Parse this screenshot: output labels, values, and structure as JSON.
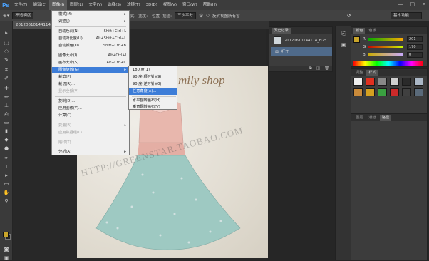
{
  "app": {
    "logo": "Ps"
  },
  "menubar": {
    "items": [
      "文件(F)",
      "编辑(E)",
      "图像(I)",
      "图层(L)",
      "文字(Y)",
      "选择(S)",
      "滤镜(T)",
      "3D(D)",
      "视图(V)",
      "窗口(W)",
      "帮助(H)"
    ],
    "active_index": 2,
    "window_controls": [
      "—",
      "□",
      "✕"
    ]
  },
  "options_bar": {
    "mode_label": "不透明度",
    "sample_label": "样式:",
    "sample_value": "正常",
    "width_label": "宽度:",
    "position_label": "位置",
    "interpolation_label": "插值:",
    "interpolation_value": "三次平分",
    "interpolation_options": [
      "三次平分"
    ],
    "checkbox_label": "旋转视图所有窗",
    "workspace_value": "基本功能"
  },
  "document_tab": {
    "label": "20120610144114_H25..."
  },
  "image_menu": {
    "rows": [
      {
        "label": "模式(M)",
        "shortcut": "",
        "submenu": true,
        "disabled": false
      },
      {
        "label": "调整(J)",
        "shortcut": "",
        "submenu": true,
        "disabled": false
      },
      {
        "label": "自动色调(N)",
        "shortcut": "Shift+Ctrl+L",
        "submenu": false,
        "disabled": false
      },
      {
        "label": "自动对比度(U)",
        "shortcut": "Alt+Shift+Ctrl+L",
        "submenu": false,
        "disabled": false
      },
      {
        "label": "自动颜色(O)",
        "shortcut": "Shift+Ctrl+B",
        "submenu": false,
        "disabled": false
      },
      {
        "label": "图像大小(I)...",
        "shortcut": "Alt+Ctrl+I",
        "submenu": false,
        "disabled": false
      },
      {
        "label": "画布大小(S)...",
        "shortcut": "Alt+Ctrl+C",
        "submenu": false,
        "disabled": false
      },
      {
        "label": "图像旋转(G)",
        "shortcut": "",
        "submenu": true,
        "disabled": false,
        "highlighted": true
      },
      {
        "label": "裁剪(P)",
        "shortcut": "",
        "submenu": false,
        "disabled": false
      },
      {
        "label": "裁切(R)...",
        "shortcut": "",
        "submenu": false,
        "disabled": false
      },
      {
        "label": "显示全部(V)",
        "shortcut": "",
        "submenu": false,
        "disabled": true
      },
      {
        "label": "复制(D)...",
        "shortcut": "",
        "submenu": false,
        "disabled": false
      },
      {
        "label": "应用图像(Y)...",
        "shortcut": "",
        "submenu": false,
        "disabled": false
      },
      {
        "label": "计算(C)...",
        "shortcut": "",
        "submenu": false,
        "disabled": false
      },
      {
        "label": "变量(B)",
        "shortcut": "",
        "submenu": true,
        "disabled": true
      },
      {
        "label": "应用数据组(L)...",
        "shortcut": "",
        "submenu": false,
        "disabled": true
      },
      {
        "label": "陷印(T)...",
        "shortcut": "",
        "submenu": false,
        "disabled": true
      },
      {
        "label": "分析(A)",
        "shortcut": "",
        "submenu": true,
        "disabled": false
      }
    ]
  },
  "rotate_submenu": {
    "rows": [
      {
        "label": "180 度(1)",
        "highlighted": false
      },
      {
        "label": "90 度(顺时针)(9)",
        "highlighted": false
      },
      {
        "label": "90 度(逆时针)(0)",
        "highlighted": false
      },
      {
        "label": "任意角度(A)...",
        "highlighted": true
      },
      {
        "label": "水平翻转画布(H)",
        "highlighted": false
      },
      {
        "label": "垂直翻转画布(V)",
        "highlighted": false
      }
    ]
  },
  "photo": {
    "script_text": "mily shop",
    "watermark_text": "HTTP://GREENSTAR.TAOBAO.COM"
  },
  "history_panel": {
    "tabs": [
      "历史记录",
      "动作"
    ],
    "rows": [
      {
        "label": "20120610144114_H25...",
        "selected": false
      },
      {
        "label": "打开",
        "selected": true
      }
    ]
  },
  "color_panel": {
    "tabs": [
      "颜色",
      "色板"
    ],
    "channels": [
      {
        "label": "R",
        "value": "201"
      },
      {
        "label": "G",
        "value": "170"
      },
      {
        "label": "B",
        "value": "0"
      }
    ],
    "foreground": "#c9a52a"
  },
  "styles_panel": {
    "tabs": [
      "调整",
      "样式"
    ]
  },
  "layers_panel": {
    "tabs": [
      "图层",
      "通道",
      "路径"
    ]
  }
}
